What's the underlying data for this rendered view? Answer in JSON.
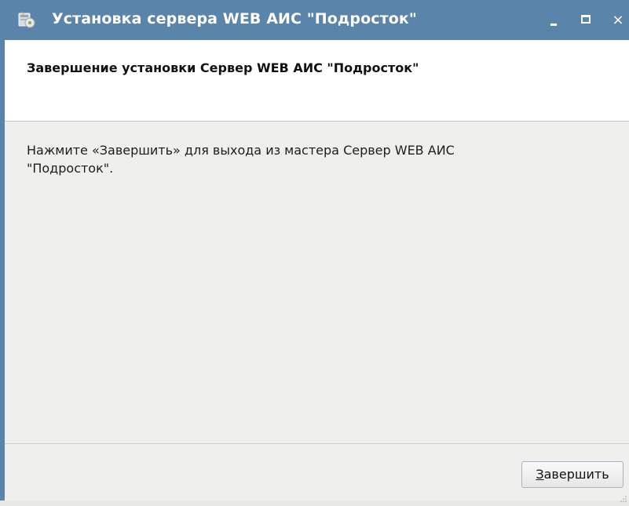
{
  "window": {
    "title": "Установка сервера WEB АИС \"Подросток\"",
    "controls": {
      "minimize": "_",
      "maximize": "□",
      "close": "×"
    }
  },
  "header": {
    "title": "Завершение установки Сервер WEB АИС \"Подросток\""
  },
  "body": {
    "message": "Нажмите «Завершить» для выхода из мастера Сервер WEB АИС \"Подросток\"."
  },
  "footer": {
    "finish_button": {
      "mnemonic": "З",
      "rest": "авершить"
    }
  },
  "icons": {
    "app": "installer-icon",
    "minimize": "minimize-icon",
    "maximize": "maximize-icon",
    "close": "close-icon",
    "grip": "resize-grip-icon"
  },
  "colors": {
    "titlebar": "#5b84ab",
    "header_bg": "#ffffff",
    "content_bg": "#efefed"
  }
}
